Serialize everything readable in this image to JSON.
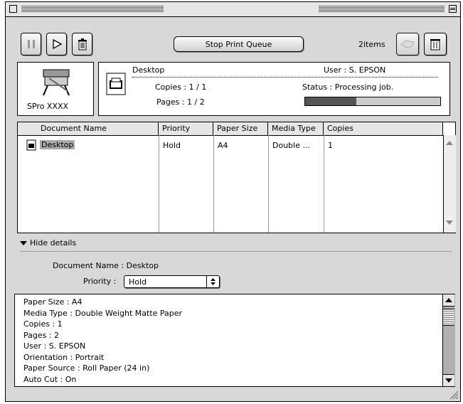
{
  "toolbar": {
    "pause_icon": "pause-icon",
    "play_icon": "play-icon",
    "trash_icon": "trash-icon",
    "stop_queue_label": "Stop Print Queue",
    "item_count": "2items"
  },
  "printer": {
    "name": "SPro XXXX",
    "doc_title": "Desktop",
    "user_label": "User : S. EPSON",
    "copies_label": "Copies : 1 / 1",
    "pages_label": "Pages : 1 / 2",
    "status_label": "Status : Processing job.",
    "progress": 0.38
  },
  "table": {
    "columns": [
      "Document Name",
      "Priority",
      "Paper Size",
      "Media Type",
      "Copies"
    ],
    "rows": [
      {
        "document": "Desktop",
        "priority": "Hold",
        "paper_size": "A4",
        "media_type": "Double ...",
        "copies": "1"
      }
    ]
  },
  "details": {
    "toggle_label": "Hide details",
    "document_name_label": "Document Name : Desktop",
    "priority_label": "Priority :",
    "priority_value": "Hold",
    "info_lines": [
      "Paper Size : A4",
      "Media Type : Double Weight Matte Paper",
      "Copies : 1",
      "Pages : 2",
      "User : S. EPSON",
      "Orientation : Portrait",
      "Paper Source : Roll Paper (24 in)",
      "Auto Cut : On"
    ]
  }
}
